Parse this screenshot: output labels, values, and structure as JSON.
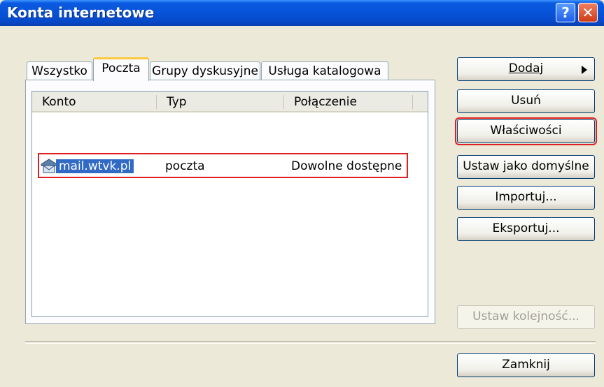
{
  "window": {
    "title": "Konta internetowe",
    "help_label": "?",
    "close_label": "✕"
  },
  "tabs": [
    {
      "label": "Wszystko"
    },
    {
      "label": "Poczta"
    },
    {
      "label": "Grupy dyskusyjne"
    },
    {
      "label": "Usługa katalogowa"
    }
  ],
  "columns": [
    {
      "label": "Konto"
    },
    {
      "label": "Typ"
    },
    {
      "label": "Połączenie"
    }
  ],
  "accounts": [
    {
      "konto": "mail.wtvk.pl",
      "typ": "poczta",
      "polaczenie": "Dowolne dostępne",
      "icon": "mail-account-icon"
    }
  ],
  "buttons": {
    "dodaj": "Dodaj",
    "usun": "Usuń",
    "wlasciwosci": "Właściwości",
    "ustaw_domyslne": "Ustaw jako domyślne",
    "importuj": "Importuj...",
    "eksportuj": "Eksportuj...",
    "ustaw_kolejnosc": "Ustaw kolejność...",
    "zamknij": "Zamknij"
  },
  "colors": {
    "selection": "#316AC5",
    "highlight_box": "#E02020",
    "titlebar": "#0653D8",
    "dialog_bg": "#ECE9D8"
  }
}
